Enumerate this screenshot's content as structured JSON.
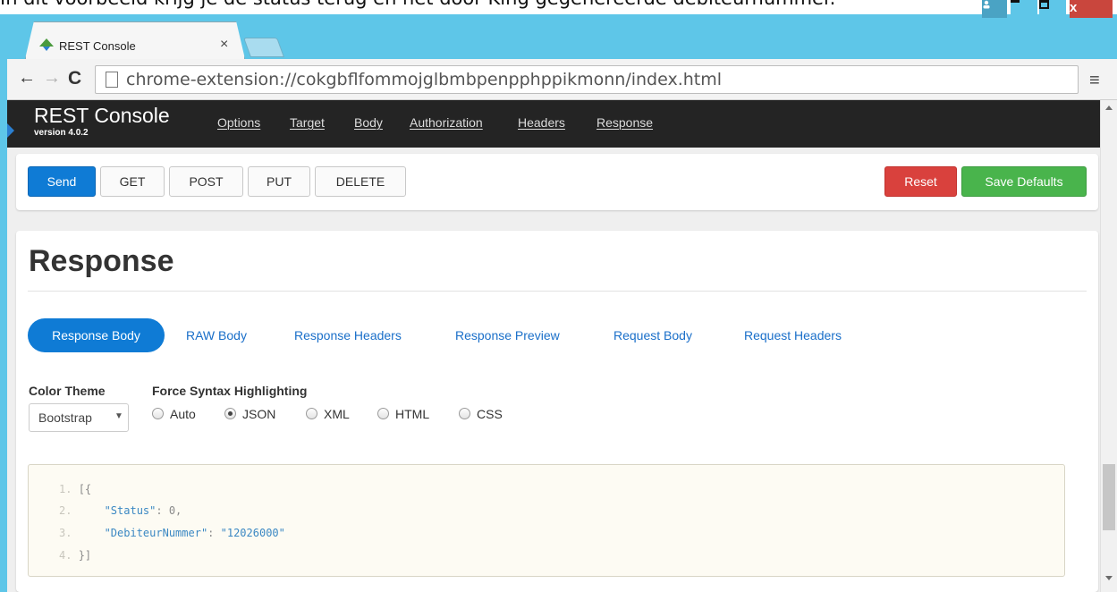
{
  "caption": "In dit voorbeeld krijg je de status terug en het door King gegenereerde debiteurnummer.",
  "browser": {
    "tab_title": "REST Console",
    "tab_close": "×",
    "url": "chrome-extension://cokgbflfommojglbmbpenpphppikmonn/index.html",
    "back": "←",
    "forward": "→",
    "reload": "C",
    "menu": "≡"
  },
  "navbar": {
    "brand": "REST Console",
    "version": "version 4.0.2",
    "links": [
      "Options",
      "Target",
      "Body",
      "Authorization",
      "Headers",
      "Response"
    ]
  },
  "toolbar": {
    "send": "Send",
    "get": "GET",
    "post": "POST",
    "put": "PUT",
    "delete": "DELETE",
    "reset": "Reset",
    "save_defaults": "Save Defaults"
  },
  "response": {
    "title": "Response",
    "tabs": [
      "Response Body",
      "RAW Body",
      "Response Headers",
      "Response Preview",
      "Request Body",
      "Request Headers"
    ],
    "color_theme_label": "Color Theme",
    "color_theme_value": "Bootstrap",
    "syntax_label": "Force Syntax Highlighting",
    "syntax_options": [
      "Auto",
      "JSON",
      "XML",
      "HTML",
      "CSS"
    ],
    "syntax_selected": "JSON",
    "code": {
      "line_numbers": [
        "1.",
        "2.",
        "3.",
        "4."
      ],
      "open": "[{",
      "status_key": "\"Status\"",
      "status_sep": ": ",
      "status_value": "0,",
      "deb_key": "\"DebiteurNummer\"",
      "deb_sep": ": ",
      "deb_value": "\"12026000\"",
      "close": "}]"
    }
  },
  "colors": {
    "primary": "#0f7bd5",
    "danger": "#d9413d",
    "success": "#49b44c",
    "navbar": "#242424",
    "window_frame": "#5ec6e8"
  }
}
